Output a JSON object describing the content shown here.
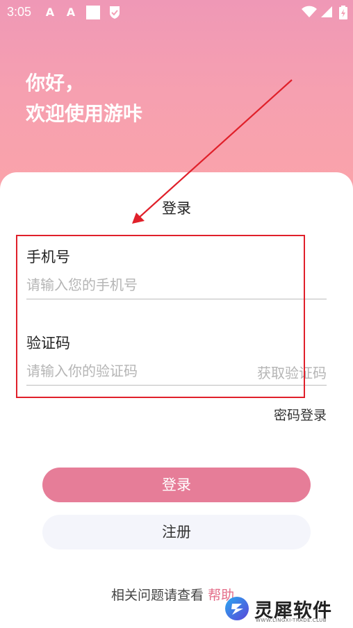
{
  "status_bar": {
    "time": "3:05"
  },
  "greeting": {
    "line1": "你好，",
    "line2": "欢迎使用游咔"
  },
  "form": {
    "title": "登录",
    "phone_label": "手机号",
    "phone_placeholder": "请输入您的手机号",
    "code_label": "验证码",
    "code_placeholder": "请输入你的验证码",
    "get_code": "获取验证码",
    "password_login": "密码登录"
  },
  "buttons": {
    "login": "登录",
    "register": "注册"
  },
  "help": {
    "text": "相关问题请查看",
    "link": "帮助"
  },
  "watermark": {
    "name": "灵犀软件",
    "sub": "WWW.LINGXI-TRADE.CLUB"
  },
  "colors": {
    "accent": "#e67d98",
    "annotation": "#e0202a"
  }
}
